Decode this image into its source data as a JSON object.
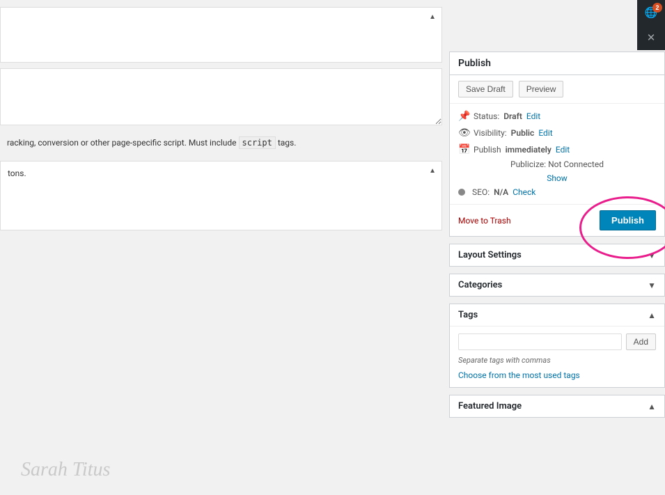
{
  "main": {
    "script_text_part1": "racking, conversion or other page-specific script. Must include ",
    "script_tag": "script",
    "script_text_part2": " tags.",
    "bottom_text": "tons."
  },
  "watermark": {
    "text": "Sarah Titus"
  },
  "top_icons": {
    "badge_count": "2",
    "globe_icon": "🌐",
    "close_icon": "✕"
  },
  "publish": {
    "title": "Publish",
    "save_draft_label": "Save Draft",
    "preview_label": "Preview",
    "status_label": "Status: ",
    "status_value": "Draft",
    "status_edit": "Edit",
    "visibility_label": "Visibility: ",
    "visibility_value": "Public",
    "visibility_edit": "Edit",
    "publish_schedule_label": "Publish ",
    "publish_schedule_value": "immediately",
    "publish_schedule_edit": "Edit",
    "publicize_label": "Publicize: Not Connected",
    "publicize_show": "Show",
    "seo_label": "SEO: ",
    "seo_value": "N/A",
    "seo_check": "Check",
    "move_to_trash": "Move to Trash",
    "publish_button": "Publish"
  },
  "layout_settings": {
    "title": "Layout Settings"
  },
  "categories": {
    "title": "Categories"
  },
  "tags": {
    "title": "Tags",
    "add_button": "Add",
    "hint": "Separate tags with commas",
    "choose_link": "Choose from the most used tags",
    "input_placeholder": ""
  },
  "featured_image": {
    "title": "Featured Image"
  }
}
